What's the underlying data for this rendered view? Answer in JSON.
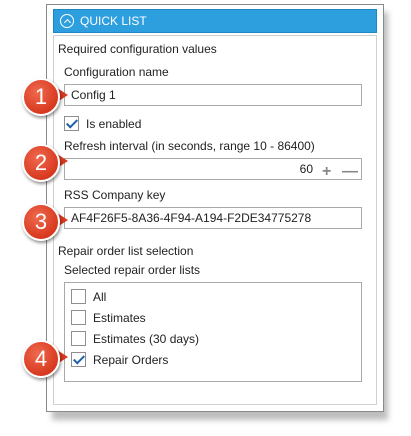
{
  "header": {
    "title": "QUICK LIST"
  },
  "sections": {
    "required_title": "Required configuration values",
    "repair_title": "Repair order list selection"
  },
  "config_name": {
    "label": "Configuration name",
    "value": "Config 1"
  },
  "enabled": {
    "label": "Is enabled",
    "checked": true
  },
  "refresh": {
    "label": "Refresh interval (in seconds, range 10 - 86400)",
    "value": "60",
    "plus": "+",
    "minus": "—"
  },
  "rss": {
    "label": "RSS Company key",
    "value": "AF4F26F5-8A36-4F94-A194-F2DE34775278"
  },
  "repair_lists": {
    "label": "Selected repair order lists",
    "items": [
      {
        "label": "All",
        "checked": false
      },
      {
        "label": "Estimates",
        "checked": false
      },
      {
        "label": "Estimates (30 days)",
        "checked": false
      },
      {
        "label": "Repair Orders",
        "checked": true
      }
    ]
  },
  "callouts": [
    "1",
    "2",
    "3",
    "4"
  ],
  "colors": {
    "header": "#2e9fde",
    "callout": "#d8391f",
    "check": "#1d5fa8"
  }
}
